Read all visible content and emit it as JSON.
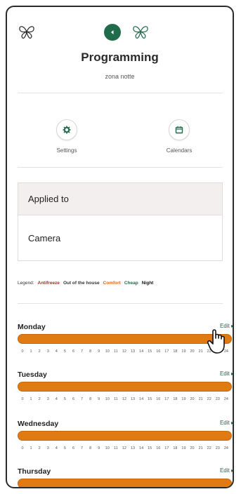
{
  "header": {
    "title": "Programming",
    "subtitle": "zona notte"
  },
  "actions": [
    {
      "label": "Settings",
      "icon": "gear-icon"
    },
    {
      "label": "Calendars",
      "icon": "calendar-icon"
    }
  ],
  "applied_card": {
    "heading": "Applied to",
    "value": "Camera"
  },
  "legend": {
    "label": "Legend:",
    "items": [
      {
        "label": "Antifreeze",
        "color": "#b3261e"
      },
      {
        "label": "Out of the house",
        "color": "#333333"
      },
      {
        "label": "Comfort",
        "color": "#d2691e"
      },
      {
        "label": "Cheap",
        "color": "#1f6b4a"
      },
      {
        "label": "Night",
        "color": "#111111"
      }
    ]
  },
  "days": [
    {
      "name": "Monday",
      "edit": "Edit ▸",
      "mode": "Comfort"
    },
    {
      "name": "Tuesday",
      "edit": "Edit ▸",
      "mode": "Comfort"
    },
    {
      "name": "Wednesday",
      "edit": "Edit ▸",
      "mode": "Comfort"
    },
    {
      "name": "Thursday",
      "edit": "Edit ▸",
      "mode": "Comfort"
    }
  ],
  "hours": [
    "0",
    "1",
    "2",
    "3",
    "4",
    "5",
    "6",
    "7",
    "8",
    "9",
    "10",
    "11",
    "12",
    "13",
    "14",
    "15",
    "16",
    "17",
    "18",
    "19",
    "20",
    "21",
    "22",
    "23",
    "24"
  ],
  "colors": {
    "accent": "#1f6b4a",
    "bar": "#e07a12"
  }
}
